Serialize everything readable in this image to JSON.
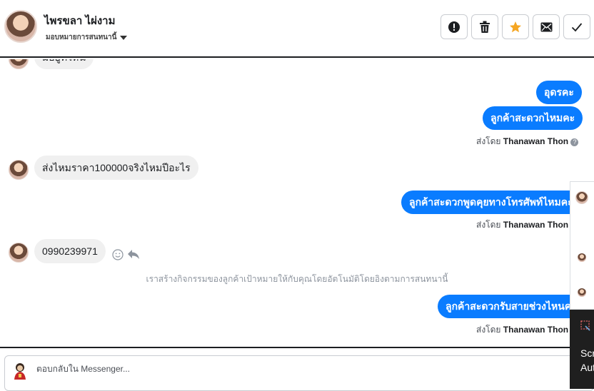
{
  "header": {
    "contact_name": "ไพรขลา ไผ่งาม",
    "assign_label": "มอบหมายการสนทนานี้",
    "buttons": [
      "spam",
      "delete",
      "star",
      "mark-unread",
      "done"
    ]
  },
  "messages": {
    "partial_top": "มีอยู่ที่ไหน",
    "out_1": "อุดรคะ",
    "out_2": "ลูกค้าสะดวกไหมคะ",
    "sent_by_prefix": "ส่งโดย",
    "sent_by_name": "Thanawan Thon",
    "in_1": "ส่งไหมราคา100000จริงไหมปีอะไร",
    "out_3": "ลูกค้าสะดวกพูดคุยทางโทรศัพท์ไหมคะ",
    "in_2": "0990239971",
    "system_note": "เราสร้างกิจกรรมของลูกค้าเป้าหมายให้กับคุณโดยอัตโนมัติโดยอิงตามการสนทนานี้",
    "out_4": "ลูกค้าสะดวกรับสายช่วงไหนคะ"
  },
  "reply": {
    "placeholder": "ตอบกลับใน Messenger..."
  },
  "side_panel": {
    "line1": "Scr",
    "line2": "Aut"
  },
  "colors": {
    "outgoing": "#0a7cff",
    "incoming": "#f0f0f0",
    "star": "#f5a623"
  }
}
